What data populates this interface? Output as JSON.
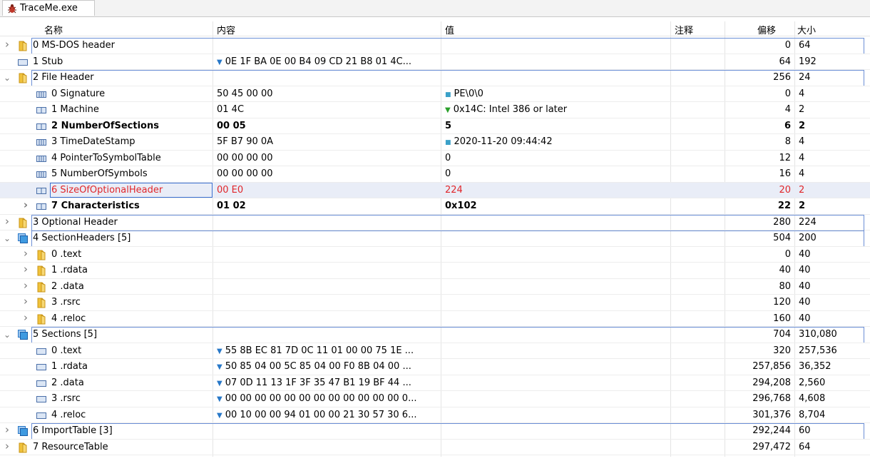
{
  "tab": {
    "title": "TraceMe.exe",
    "icon": "bug-icon"
  },
  "columns": {
    "name": "名称",
    "content": "内容",
    "value": "值",
    "comment": "注释",
    "offset": "偏移",
    "size": "大小"
  },
  "rows": [
    {
      "level": 0,
      "expand": "collapsed",
      "icon": "folder-icon",
      "name": "0 MS-DOS header",
      "content": "",
      "value": "",
      "marker": "",
      "offset": "0",
      "size": "64",
      "style": "",
      "outline": "top"
    },
    {
      "level": 0,
      "expand": "none",
      "icon": "block-icon",
      "name": "1 Stub",
      "content": "0E 1F BA 0E 00 B4 09 CD 21 B8 01 4C...",
      "contentArrow": true,
      "value": "",
      "marker": "",
      "offset": "64",
      "size": "192",
      "style": "",
      "outline": ""
    },
    {
      "level": 0,
      "expand": "expanded",
      "icon": "folder-icon",
      "name": "2 File Header",
      "content": "",
      "value": "",
      "marker": "",
      "offset": "256",
      "size": "24",
      "style": "",
      "outline": "mid"
    },
    {
      "level": 1,
      "expand": "none",
      "icon": "field-icon",
      "name": "0 Signature",
      "content": "50 45 00 00",
      "value": "PE\\0\\0",
      "marker": "dot",
      "offset": "0",
      "size": "4",
      "style": "",
      "outline": ""
    },
    {
      "level": 1,
      "expand": "none",
      "icon": "field2-icon",
      "name": "1 Machine",
      "content": "01 4C",
      "value": "0x14C: Intel 386 or later",
      "marker": "green",
      "offset": "4",
      "size": "2",
      "style": "",
      "outline": ""
    },
    {
      "level": 1,
      "expand": "none",
      "icon": "field2-icon",
      "name": "2 NumberOfSections",
      "content": "00 05",
      "value": "5",
      "marker": "",
      "offset": "6",
      "size": "2",
      "style": "bold",
      "outline": ""
    },
    {
      "level": 1,
      "expand": "none",
      "icon": "field-icon",
      "name": "3 TimeDateStamp",
      "content": "5F B7 90 0A",
      "value": "2020-11-20 09:44:42",
      "marker": "dot",
      "offset": "8",
      "size": "4",
      "style": "",
      "outline": ""
    },
    {
      "level": 1,
      "expand": "none",
      "icon": "field-icon",
      "name": "4 PointerToSymbolTable",
      "content": "00 00 00 00",
      "value": "0",
      "marker": "",
      "offset": "12",
      "size": "4",
      "style": "",
      "outline": ""
    },
    {
      "level": 1,
      "expand": "none",
      "icon": "field-icon",
      "name": "5 NumberOfSymbols",
      "content": "00 00 00 00",
      "value": "0",
      "marker": "",
      "offset": "16",
      "size": "4",
      "style": "",
      "outline": ""
    },
    {
      "level": 1,
      "expand": "none",
      "icon": "field2-icon",
      "name": "6 SizeOfOptionalHeader",
      "content": "00 E0",
      "value": "224",
      "marker": "",
      "offset": "20",
      "size": "2",
      "style": "red sel",
      "outline": ""
    },
    {
      "level": 1,
      "expand": "collapsed",
      "icon": "field2-icon",
      "name": "7 Characteristics",
      "content": "01 02",
      "value": "0x102",
      "marker": "",
      "offset": "22",
      "size": "2",
      "style": "bold",
      "outline": ""
    },
    {
      "level": 0,
      "expand": "collapsed",
      "icon": "folder-icon",
      "name": "3 Optional Header",
      "content": "",
      "value": "",
      "marker": "",
      "offset": "280",
      "size": "224",
      "style": "",
      "outline": "mid"
    },
    {
      "level": 0,
      "expand": "expanded",
      "icon": "array-icon",
      "name": "4 SectionHeaders [5]",
      "content": "",
      "value": "",
      "marker": "",
      "offset": "504",
      "size": "200",
      "style": "",
      "outline": "mid"
    },
    {
      "level": 1,
      "expand": "collapsed",
      "icon": "folder-icon",
      "name": "0 .text",
      "content": "",
      "value": "",
      "marker": "",
      "offset": "0",
      "size": "40",
      "style": "",
      "outline": ""
    },
    {
      "level": 1,
      "expand": "collapsed",
      "icon": "folder-icon",
      "name": "1 .rdata",
      "content": "",
      "value": "",
      "marker": "",
      "offset": "40",
      "size": "40",
      "style": "",
      "outline": ""
    },
    {
      "level": 1,
      "expand": "collapsed",
      "icon": "folder-icon",
      "name": "2 .data",
      "content": "",
      "value": "",
      "marker": "",
      "offset": "80",
      "size": "40",
      "style": "",
      "outline": ""
    },
    {
      "level": 1,
      "expand": "collapsed",
      "icon": "folder-icon",
      "name": "3 .rsrc",
      "content": "",
      "value": "",
      "marker": "",
      "offset": "120",
      "size": "40",
      "style": "",
      "outline": ""
    },
    {
      "level": 1,
      "expand": "collapsed",
      "icon": "folder-icon",
      "name": "4 .reloc",
      "content": "",
      "value": "",
      "marker": "",
      "offset": "160",
      "size": "40",
      "style": "",
      "outline": ""
    },
    {
      "level": 0,
      "expand": "expanded",
      "icon": "array-icon",
      "name": "5 Sections [5]",
      "content": "",
      "value": "",
      "marker": "",
      "offset": "704",
      "size": "310,080",
      "style": "",
      "outline": "mid"
    },
    {
      "level": 1,
      "expand": "none",
      "icon": "block-icon",
      "name": "0 .text",
      "content": "55 8B EC 81 7D 0C 11 01 00 00 75 1E ...",
      "contentArrow": true,
      "value": "",
      "marker": "",
      "offset": "320",
      "size": "257,536",
      "style": "",
      "outline": ""
    },
    {
      "level": 1,
      "expand": "none",
      "icon": "block-icon",
      "name": "1 .rdata",
      "content": "50 85 04 00 5C 85 04 00 F0 8B 04 00 ...",
      "contentArrow": true,
      "value": "",
      "marker": "",
      "offset": "257,856",
      "size": "36,352",
      "style": "",
      "outline": ""
    },
    {
      "level": 1,
      "expand": "none",
      "icon": "block-icon",
      "name": "2 .data",
      "content": "07 0D 11 13 1F 3F 35 47 B1 19 BF 44 ...",
      "contentArrow": true,
      "value": "",
      "marker": "",
      "offset": "294,208",
      "size": "2,560",
      "style": "",
      "outline": ""
    },
    {
      "level": 1,
      "expand": "none",
      "icon": "block-icon",
      "name": "3 .rsrc",
      "content": "00 00 00 00 00 00 00 00 00 00 00 00 0...",
      "contentArrow": true,
      "value": "",
      "marker": "",
      "offset": "296,768",
      "size": "4,608",
      "style": "",
      "outline": ""
    },
    {
      "level": 1,
      "expand": "none",
      "icon": "block-icon",
      "name": "4 .reloc",
      "content": "00 10 00 00 94 01 00 00 21 30 57 30 6...",
      "contentArrow": true,
      "value": "",
      "marker": "",
      "offset": "301,376",
      "size": "8,704",
      "style": "",
      "outline": ""
    },
    {
      "level": 0,
      "expand": "collapsed",
      "icon": "array-icon",
      "name": "6 ImportTable [3]",
      "content": "",
      "value": "",
      "marker": "",
      "offset": "292,244",
      "size": "60",
      "style": "",
      "outline": "mid"
    },
    {
      "level": 0,
      "expand": "collapsed",
      "icon": "folder-icon",
      "name": "7 ResourceTable",
      "content": "",
      "value": "",
      "marker": "",
      "offset": "297,472",
      "size": "64",
      "style": "",
      "outline": ""
    }
  ],
  "colors": {
    "selectedText": "#e0262a",
    "selectedRowBg": "#e9edf7",
    "outline": "#6b8fd6",
    "arrow": "#2878c8",
    "green": "#2aa02a"
  }
}
